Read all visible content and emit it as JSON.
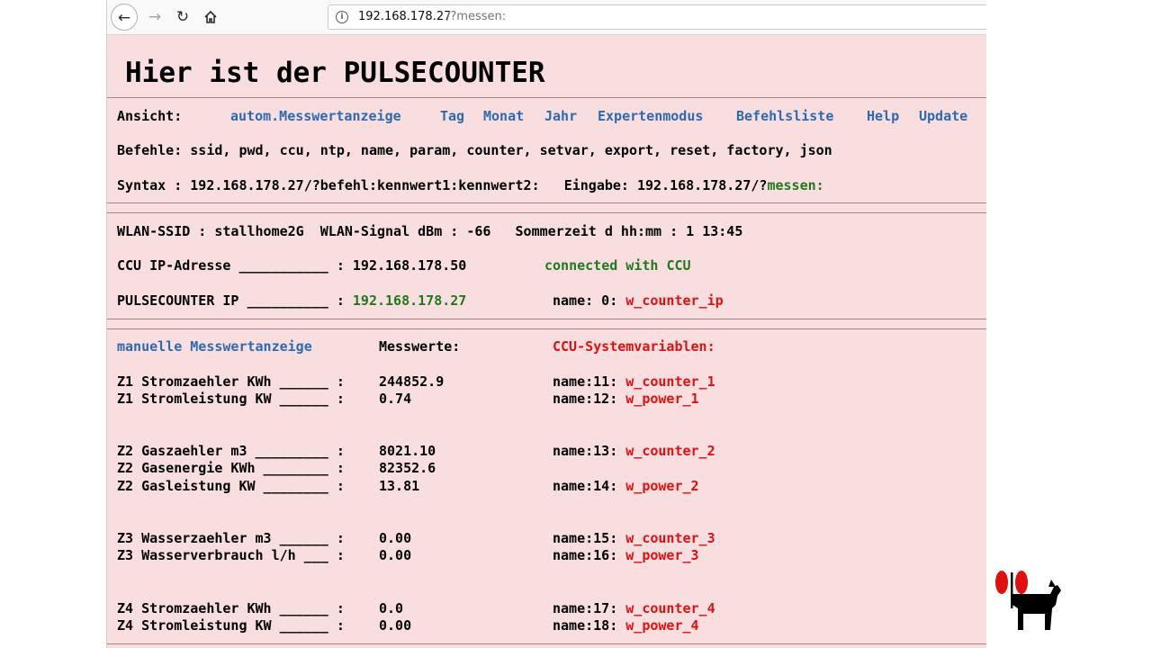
{
  "browser": {
    "url_host": "192.168.178.27",
    "url_path": "/?messen:"
  },
  "page": {
    "title": "Hier ist der PULSECOUNTER",
    "ansicht_label": "Ansicht:",
    "nav": [
      "autom.Messwertanzeige",
      "Tag",
      "Monat",
      "Jahr",
      "Expertenmodus",
      "Befehlsliste",
      "Help",
      "Update"
    ],
    "befehle": "Befehle: ssid, pwd, ccu, ntp, name, param, counter, setvar, export, reset, factory, json",
    "syntax": "Syntax : 192.168.178.27/?befehl:kennwert1:kennwert2:   Eingabe: 192.168.178.27/?",
    "syntax_cmd": "messen:",
    "wlan": "WLAN-SSID : stallhome2G  WLAN-Signal dBm : -66   Sommerzeit d hh:mm : 1 13:45",
    "ccu_ip_label": "CCU IP-Adresse ___________ : 192.168.178.50",
    "ccu_status": "connected with CCU",
    "pc_ip_label": "PULSECOUNTER IP __________ : ",
    "pc_ip": "192.168.178.27",
    "pc_name_label": "name: 0: ",
    "pc_name_var": "w_counter_ip",
    "manual_link": "manuelle Messwertanzeige",
    "messwerte_header": "Messwerte:",
    "ccu_vars_header": "CCU-Systemvariablen:",
    "rows": [
      {
        "label": "Z1 Stromzaehler KWh ______ :",
        "value": "244852.9",
        "name_label": "name:11: ",
        "var": "w_counter_1"
      },
      {
        "label": "Z1 Stromleistung KW ______ :",
        "value": "0.74",
        "name_label": "name:12: ",
        "var": "w_power_1"
      },
      {
        "label": "Z2 Gaszaehler m3 _________ :",
        "value": "8021.10",
        "name_label": "name:13: ",
        "var": "w_counter_2"
      },
      {
        "label": "Z2 Gasenergie KWh ________ :",
        "value": "82352.6",
        "name_label": "",
        "var": ""
      },
      {
        "label": "Z2 Gasleistung KW ________ :",
        "value": "13.81",
        "name_label": "name:14: ",
        "var": "w_power_2"
      },
      {
        "label": "Z3 Wasserzaehler m3 ______ :",
        "value": "0.00",
        "name_label": "name:15: ",
        "var": "w_counter_3"
      },
      {
        "label": "Z3 Wasserverbrauch l/h ___ :",
        "value": "0.00",
        "name_label": "name:16: ",
        "var": "w_power_3"
      },
      {
        "label": "Z4 Stromzaehler KWh ______ :",
        "value": "0.0",
        "name_label": "name:17: ",
        "var": "w_counter_4"
      },
      {
        "label": "Z4 Stromleistung KW ______ :",
        "value": "0.00",
        "name_label": "name:18: ",
        "var": "w_power_4"
      }
    ]
  },
  "icons": {
    "back": "back-arrow-icon",
    "forward": "forward-arrow-icon",
    "reload": "reload-icon",
    "home": "home-icon",
    "info": "info-icon",
    "logo": "dog-with-antenna-logo"
  },
  "colors": {
    "page_bg": "#f8dede",
    "link": "#2e6ab0",
    "green": "#1f7a1f",
    "red": "#e01010"
  }
}
